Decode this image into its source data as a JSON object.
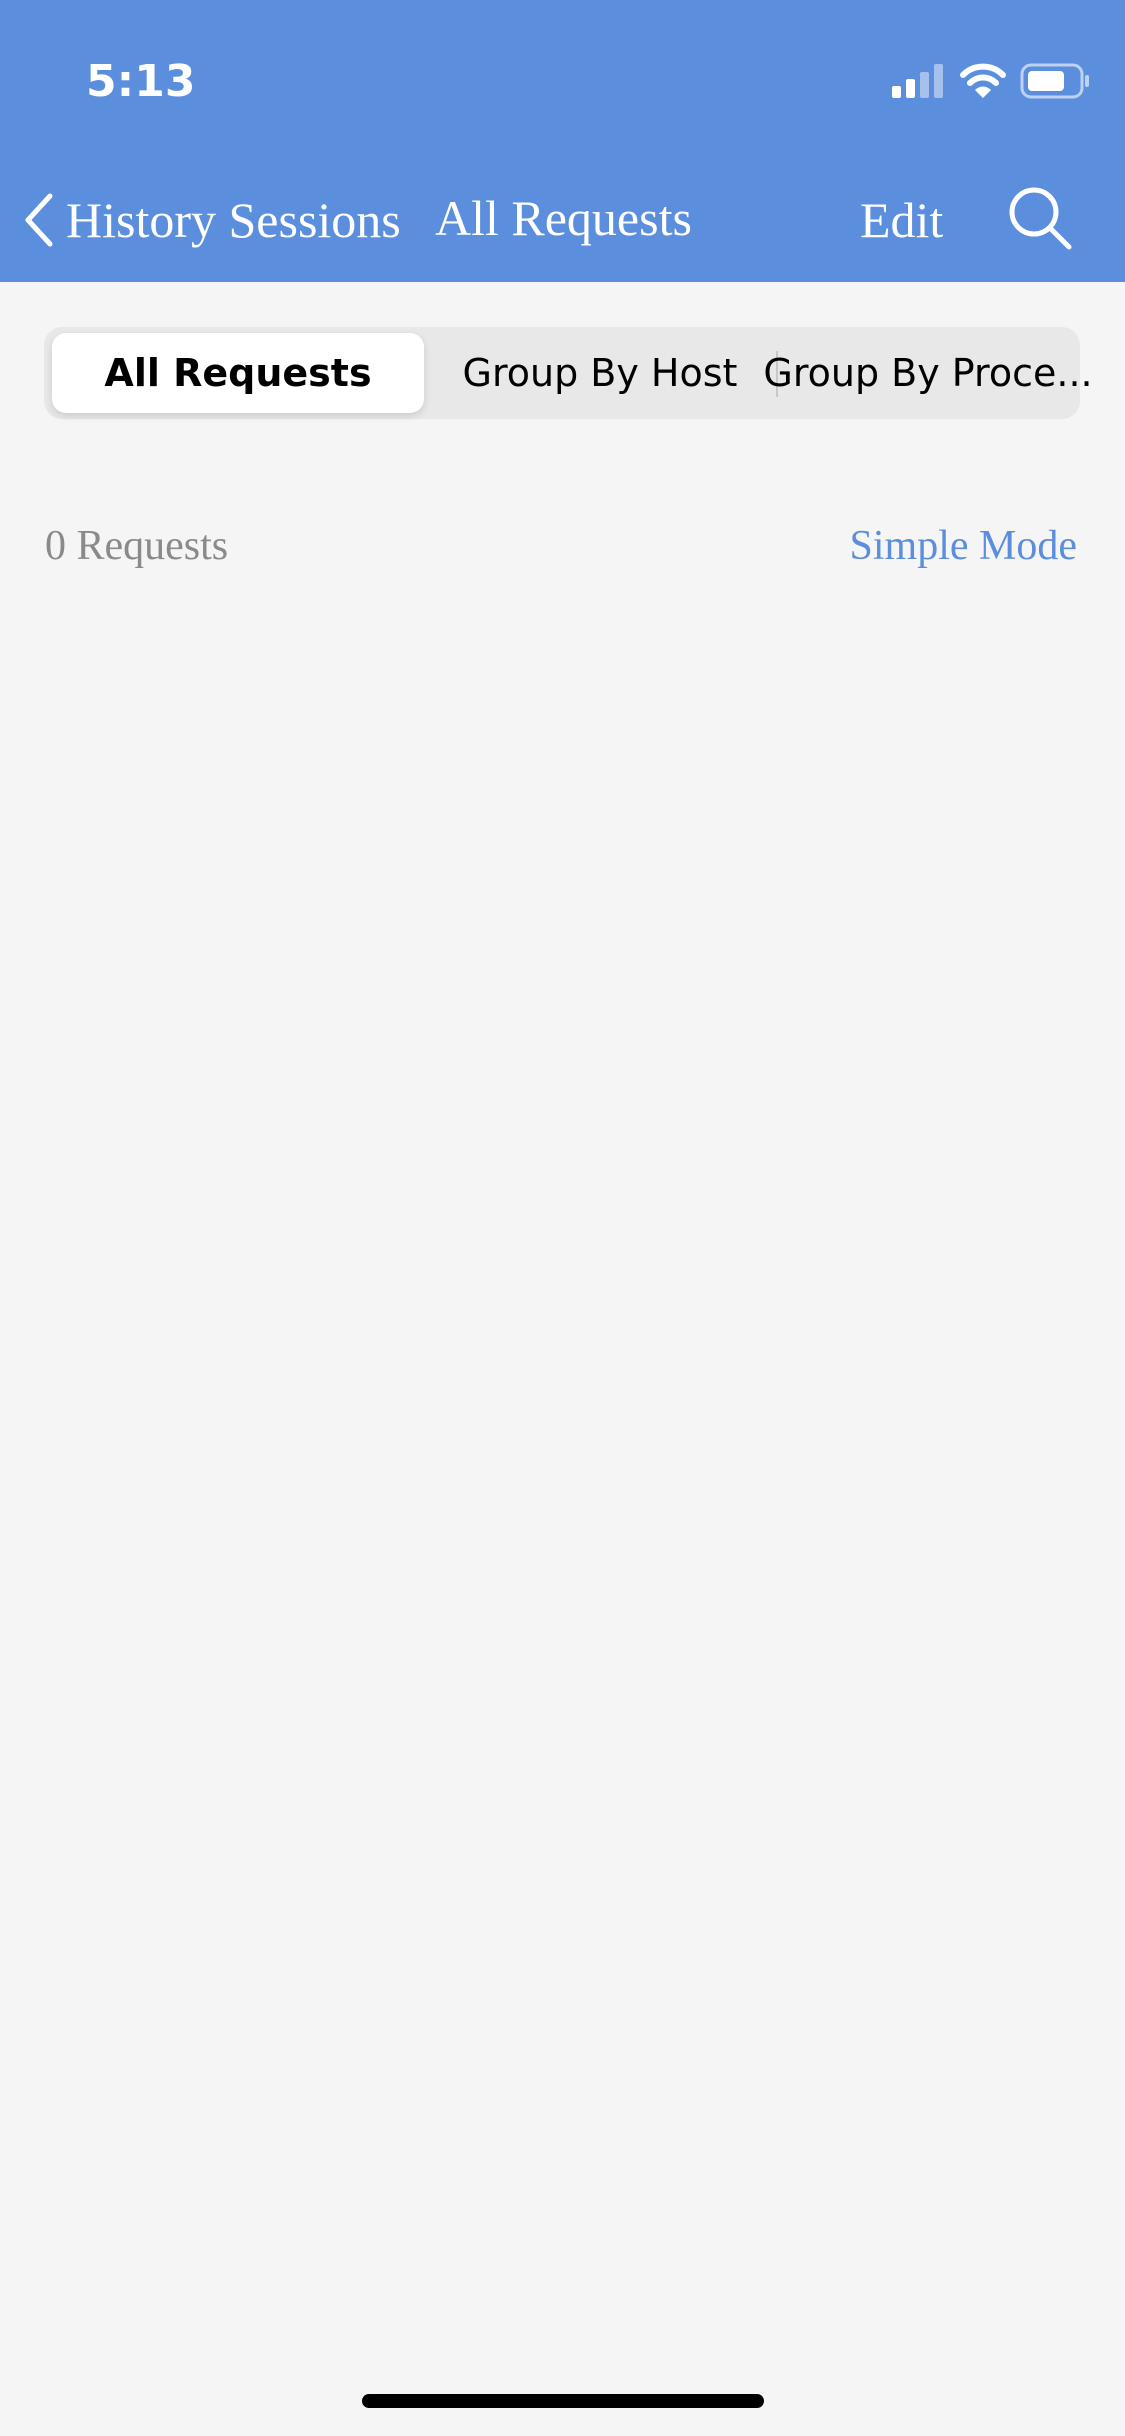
{
  "status_bar": {
    "time": "5:13"
  },
  "nav_bar": {
    "back_label": "History Sessions",
    "title": "All Requests",
    "edit_label": "Edit"
  },
  "segmented_control": {
    "segments": [
      {
        "label": "All Requests",
        "selected": true
      },
      {
        "label": "Group By Host",
        "selected": false
      },
      {
        "label": "Group By Proce...",
        "selected": false
      }
    ]
  },
  "list_header": {
    "count_label": "0 Requests",
    "mode_label": "Simple Mode"
  },
  "icons": {
    "back": "chevron-left-icon",
    "search": "search-icon",
    "signal": "cellular-signal-icon",
    "wifi": "wifi-icon",
    "battery": "battery-icon"
  },
  "colors": {
    "header_bg": "#5b8edc",
    "accent": "#5b8edc",
    "background": "#f5f5f5",
    "segment_bg": "#e8e8e8",
    "muted_text": "#8a8a8a"
  }
}
